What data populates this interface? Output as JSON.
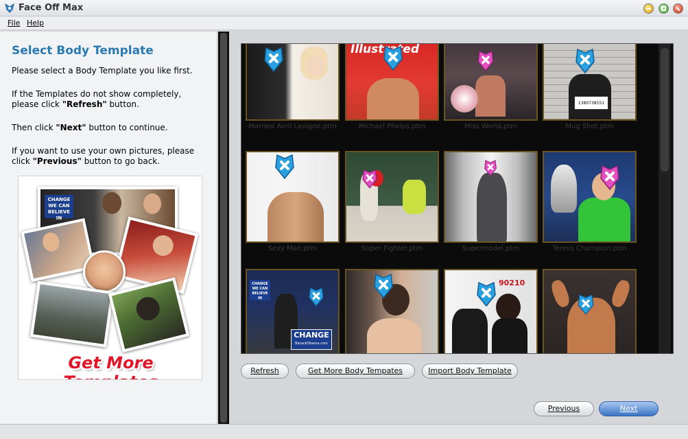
{
  "window": {
    "title": "Face Off Max"
  },
  "menu": {
    "file": "File",
    "help": "Help"
  },
  "left_panel": {
    "heading": "Select Body Template",
    "line1": "Please select a Body Template you like first.",
    "line2_pre": "If the Templates do not show completely, please click ",
    "line2_bold": "\"Refresh\"",
    "line2_post": " button.",
    "line3_pre": "Then click ",
    "line3_bold": "\"Next\"",
    "line3_post": " button to continue.",
    "line4_pre": "If you want to use your own pictures, please click ",
    "line4_bold": "\"Previous\"",
    "line4_post": " button to go back.",
    "promo_text": "Get More Templates",
    "promo_sign_line1": "CHANGE",
    "promo_sign_line2": "WE CAN",
    "promo_sign_line3": "BELIEVE IN"
  },
  "templates": [
    {
      "caption": "Married Avril Lavigne.ptm"
    },
    {
      "caption": "Michael Phelps.ptm",
      "magazine": "Sports Illustrated"
    },
    {
      "caption": "Miss World.ptm"
    },
    {
      "caption": "Mug Shot.ptm",
      "placard": "1380738551"
    },
    {
      "caption": "Sexy Man.ptm"
    },
    {
      "caption": "Super Fighter.ptm"
    },
    {
      "caption": "Supermodel.ptm"
    },
    {
      "caption": "Tennis Champion.ptm"
    },
    {
      "caption": "",
      "sign_line1": "CHANGE",
      "sign_line2": "WE CAN BELIEVE IN",
      "sign_big": "CHANGE",
      "sign_small": "BarackObama.com"
    },
    {
      "caption": ""
    },
    {
      "caption": "",
      "backdrop": "90210"
    },
    {
      "caption": ""
    }
  ],
  "buttons": {
    "refresh": "Refresh",
    "get_more": "Get More Body Tempates",
    "import": "Import Body Template",
    "previous": "Previous",
    "next": "Next"
  },
  "colors": {
    "heading": "#2a7ab0",
    "promo": "#e2162a",
    "tile_border": "#6b5420",
    "face_icon": "#2aa0e0"
  }
}
